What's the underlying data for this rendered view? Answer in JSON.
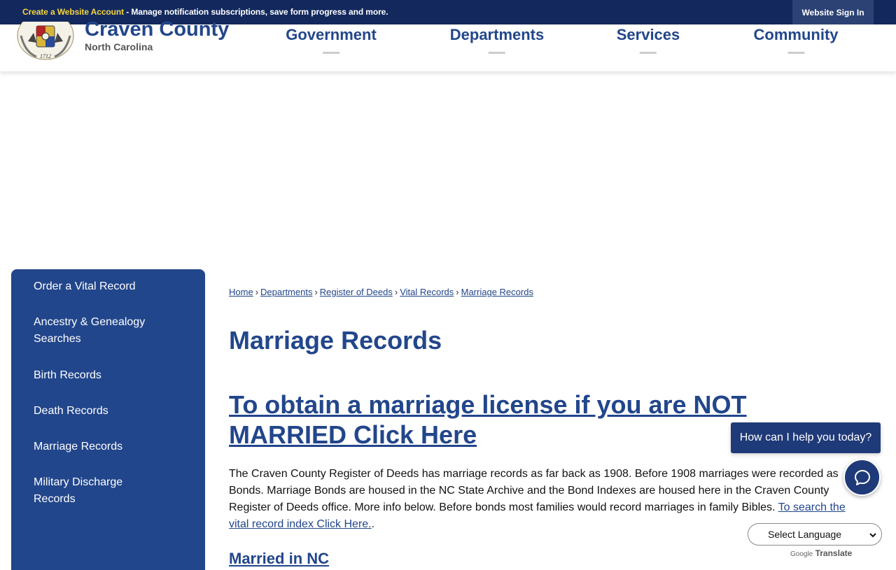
{
  "topbar": {
    "account_link": "Create a Website Account",
    "account_desc": " - Manage notification subscriptions, save form progress and more.",
    "sign_in": "Website Sign In"
  },
  "header": {
    "brand_name": "Craven County",
    "brand_sub": "North Carolina",
    "seal_year": "1712",
    "nav": [
      "Government",
      "Departments",
      "Services",
      "Community"
    ]
  },
  "sidebar": {
    "items": [
      "Order a Vital Record",
      "Ancestry & Genealogy Searches",
      "Birth Records",
      "Death Records",
      "Marriage Records",
      "Military Discharge Records"
    ]
  },
  "breadcrumb": [
    "Home",
    "Departments",
    "Register of Deeds",
    "Vital Records",
    "Marriage Records"
  ],
  "main": {
    "title": "Marriage Records",
    "license_link": "To obtain a marriage license if you are NOT MARRIED Click Here",
    "body": "The Craven County Register of Deeds has marriage records as far back as 1908. Before 1908 marriages were recorded as Bonds. Marriage Bonds are housed in the NC State Archive and the Bond Indexes are housed here in the Craven County Register of Deeds office. More info below. Before bonds most families would record marriages in family Bibles.  ",
    "body_link": "To search the vital record index Click Here.",
    "body_end": ".",
    "subhead": "Married in NC"
  },
  "chat": {
    "prompt": "How can I help you today?",
    "icon": "chat-bubble-icon"
  },
  "translate": {
    "select_value": "Select Language",
    "powered_google": "Google",
    "powered_translate": "Translate"
  },
  "colors": {
    "brand_blue": "#22468b",
    "topbar_navy": "#13295e",
    "account_yellow": "#f6d53b"
  }
}
